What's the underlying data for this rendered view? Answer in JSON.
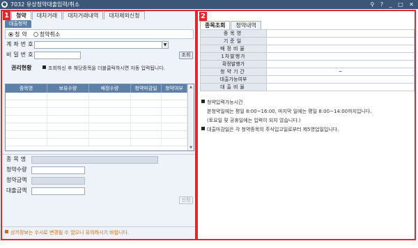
{
  "window": {
    "app_icon": "app-logo-icon",
    "title": "7032 유상청약대출입력/취소",
    "controls": "⚲ ? _ □ ✕"
  },
  "badges": {
    "left": "1",
    "right": "2"
  },
  "left": {
    "tabs": [
      "청약",
      "대차거래",
      "대차거래내역",
      "대차제외신청"
    ],
    "subtab": "대출청약",
    "radios": [
      {
        "label": "청약",
        "selected": true
      },
      {
        "label": "청약취소",
        "selected": false
      }
    ],
    "account_label": "계좌번호",
    "account_value": "",
    "password_label": "비밀번호",
    "password_value": "",
    "search_button": "조회",
    "rights": {
      "title": "권리현황",
      "note": "조회하신 후 해당종목을 더블클릭하시면 자동 입력됩니다."
    },
    "grid": {
      "columns": [
        "종목명",
        "보유수량",
        "배정수량",
        "청약마감일",
        "청약여부"
      ],
      "rows": 7
    },
    "form": {
      "stock_label": "종목명",
      "qty_label": "청약수량",
      "amount_label": "청약금액",
      "loan_label": "대출금액",
      "apply_button": "신청"
    },
    "warning": "상기정보는 수시로 변경될 수 있으니 유의하시기 바랍니다."
  },
  "right": {
    "tabs": [
      "종목조회",
      "청약내역"
    ],
    "table": [
      {
        "label": "종목명",
        "value": ""
      },
      {
        "label": "기준일",
        "value": ""
      },
      {
        "label": "배정비율",
        "value": ""
      },
      {
        "label": "1차발행가",
        "value": ""
      },
      {
        "label": "확정발행가",
        "value": ""
      },
      {
        "label": "청약기간",
        "value": "~"
      },
      {
        "label": "대출가능여부",
        "value": ""
      },
      {
        "label": "대출비율",
        "value": ""
      }
    ],
    "notices": {
      "time_title": "청약입력가능시간",
      "time_line1": "본청약일에는 평일 8:00~16:00, 마지막 일에는 평일 8:00~14:00까지입니다.",
      "time_line2": "(토요일 및 공휴일에는 입력이 되지 않습니다.)",
      "deadline": "대출마감일은 각 청약종목의 주식입고일로부터 제5영업일입니다."
    }
  }
}
